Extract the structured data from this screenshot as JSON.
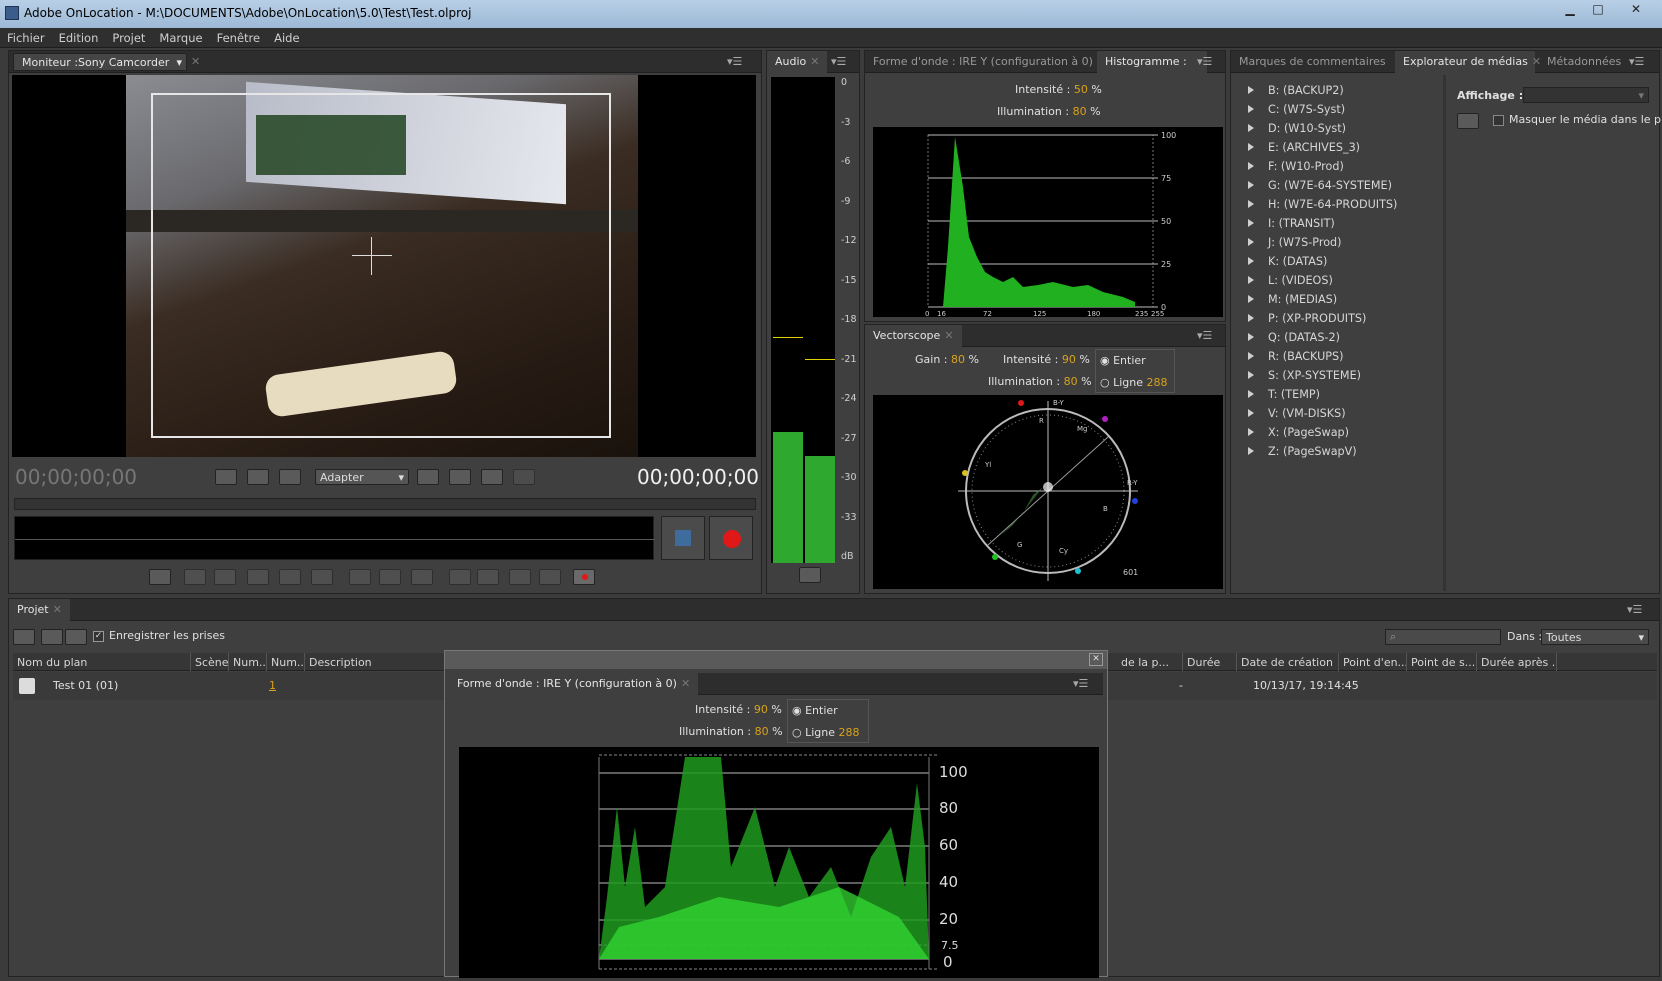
{
  "window": {
    "title": "Adobe OnLocation - M:\\DOCUMENTS\\Adobe\\OnLocation\\5.0\\Test\\Test.olproj",
    "minimize": "▁",
    "maximize": "□",
    "close": "✕"
  },
  "menu": [
    "Fichier",
    "Edition",
    "Projet",
    "Marque",
    "Fenêtre",
    "Aide"
  ],
  "monitor": {
    "dropdown": "Moniteur :Sony Camcorder",
    "timecode_left": "00;00;00;00",
    "timecode_right": "00;00;00;00",
    "fit": "Adapter"
  },
  "audio": {
    "tab": "Audio",
    "scale": [
      "0",
      "-3",
      "-6",
      "-9",
      "-12",
      "-15",
      "-18",
      "-21",
      "-24",
      "-27",
      "-30",
      "-33",
      "dB"
    ],
    "left_level": 0.27,
    "right_level": 0.22
  },
  "waveform_tab": "Forme d'onde : IRE Y (configuration à 0)",
  "histogram": {
    "tab": "Histogramme :",
    "intensity_label": "Intensité :",
    "intensity": "50",
    "illumination_label": "Illumination :",
    "illumination": "80",
    "pct": "%",
    "y_ticks": [
      "100",
      "75",
      "50",
      "25",
      "0"
    ],
    "x_ticks": [
      "0",
      "16",
      "72",
      "125",
      "180",
      "235",
      "255"
    ]
  },
  "vectorscope": {
    "tab": "Vectorscope",
    "gain_label": "Gain :",
    "gain": "80",
    "intensity_label": "Intensité :",
    "intensity": "90",
    "illumination_label": "Illumination :",
    "illumination": "80",
    "pct": "%",
    "opt_entier": "Entier",
    "opt_ligne": "Ligne",
    "ligne_value": "288",
    "corner": "601",
    "axis_labels": [
      "B-Y",
      "R-Y",
      "R",
      "Mg",
      "B",
      "Cy",
      "G",
      "Yl"
    ]
  },
  "media": {
    "tabs": [
      "Marques de commentaires",
      "Explorateur de médias",
      "Métadonnées"
    ],
    "drives": [
      "B: (BACKUP2)",
      "C: (W7S-Syst)",
      "D: (W10-Syst)",
      "E: (ARCHIVES_3)",
      "F: (W10-Prod)",
      "G: (W7E-64-SYSTEME)",
      "H: (W7E-64-PRODUITS)",
      "I: (TRANSIT)",
      "J: (W7S-Prod)",
      "K: (DATAS)",
      "L: (VIDEOS)",
      "M: (MEDIAS)",
      "P: (XP-PRODUITS)",
      "Q: (DATAS-2)",
      "R: (BACKUPS)",
      "S: (XP-SYSTEME)",
      "T: (TEMP)",
      "V: (VM-DISKS)",
      "X: (PageSwap)",
      "Z: (PageSwapV)"
    ],
    "affichage_label": "Affichage :",
    "hide_media": "Masquer le média dans le pro"
  },
  "project": {
    "tab": "Projet",
    "record_takes": "Enregistrer les prises",
    "dans_label": "Dans :",
    "dans_value": "Toutes",
    "columns_left": [
      "Nom du plan",
      "Scène",
      "Num...",
      "Num...",
      "Description"
    ],
    "columns_right": [
      "de la p...",
      "Durée",
      "Date de création",
      "Point d'en...",
      "Point de s...",
      "Durée après ..."
    ],
    "row": {
      "name": "Test 01 (01)",
      "num": "1",
      "duree": "-",
      "date": "10/13/17, 19:14:45"
    }
  },
  "floating": {
    "tab": "Forme d'onde : IRE Y (configuration à 0)",
    "intensity_label": "Intensité :",
    "intensity": "90",
    "illumination_label": "Illumination :",
    "illumination": "80",
    "pct": "%",
    "opt_entier": "Entier",
    "opt_ligne": "Ligne",
    "ligne_value": "288",
    "scale": [
      "100",
      "80",
      "60",
      "40",
      "20",
      "7.5",
      "0"
    ],
    "close": "✕"
  },
  "colors": {
    "accent": "#d8a21a",
    "waveform": "#2fd12f",
    "record": "#e01818",
    "panel": "#3f3f3f"
  }
}
